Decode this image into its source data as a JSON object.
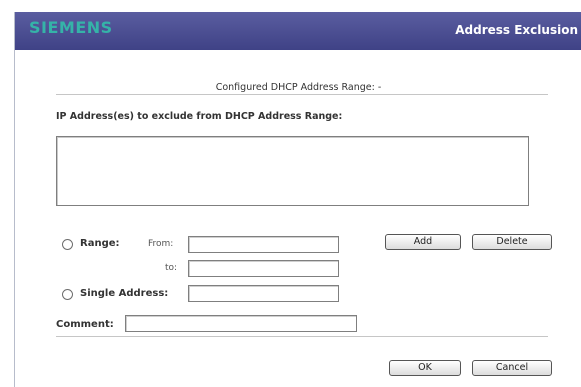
{
  "header": {
    "logo": "SIEMENS",
    "title": "Address Exclusion",
    "brand_color": "#35b3a8",
    "bar_color": "#4b4e92"
  },
  "main": {
    "configured_range": "Configured DHCP Address Range: -",
    "exclude_label": "IP Address(es) to exclude from DHCP Address Range:",
    "range_label": "Range:",
    "from_label": "From:",
    "to_label": "to:",
    "single_label": "Single Address:",
    "comment_label": "Comment:",
    "from_value": "",
    "to_value": "",
    "single_value": "",
    "comment_value": ""
  },
  "buttons": {
    "add": "Add",
    "delete": "Delete",
    "ok": "OK",
    "cancel": "Cancel"
  }
}
